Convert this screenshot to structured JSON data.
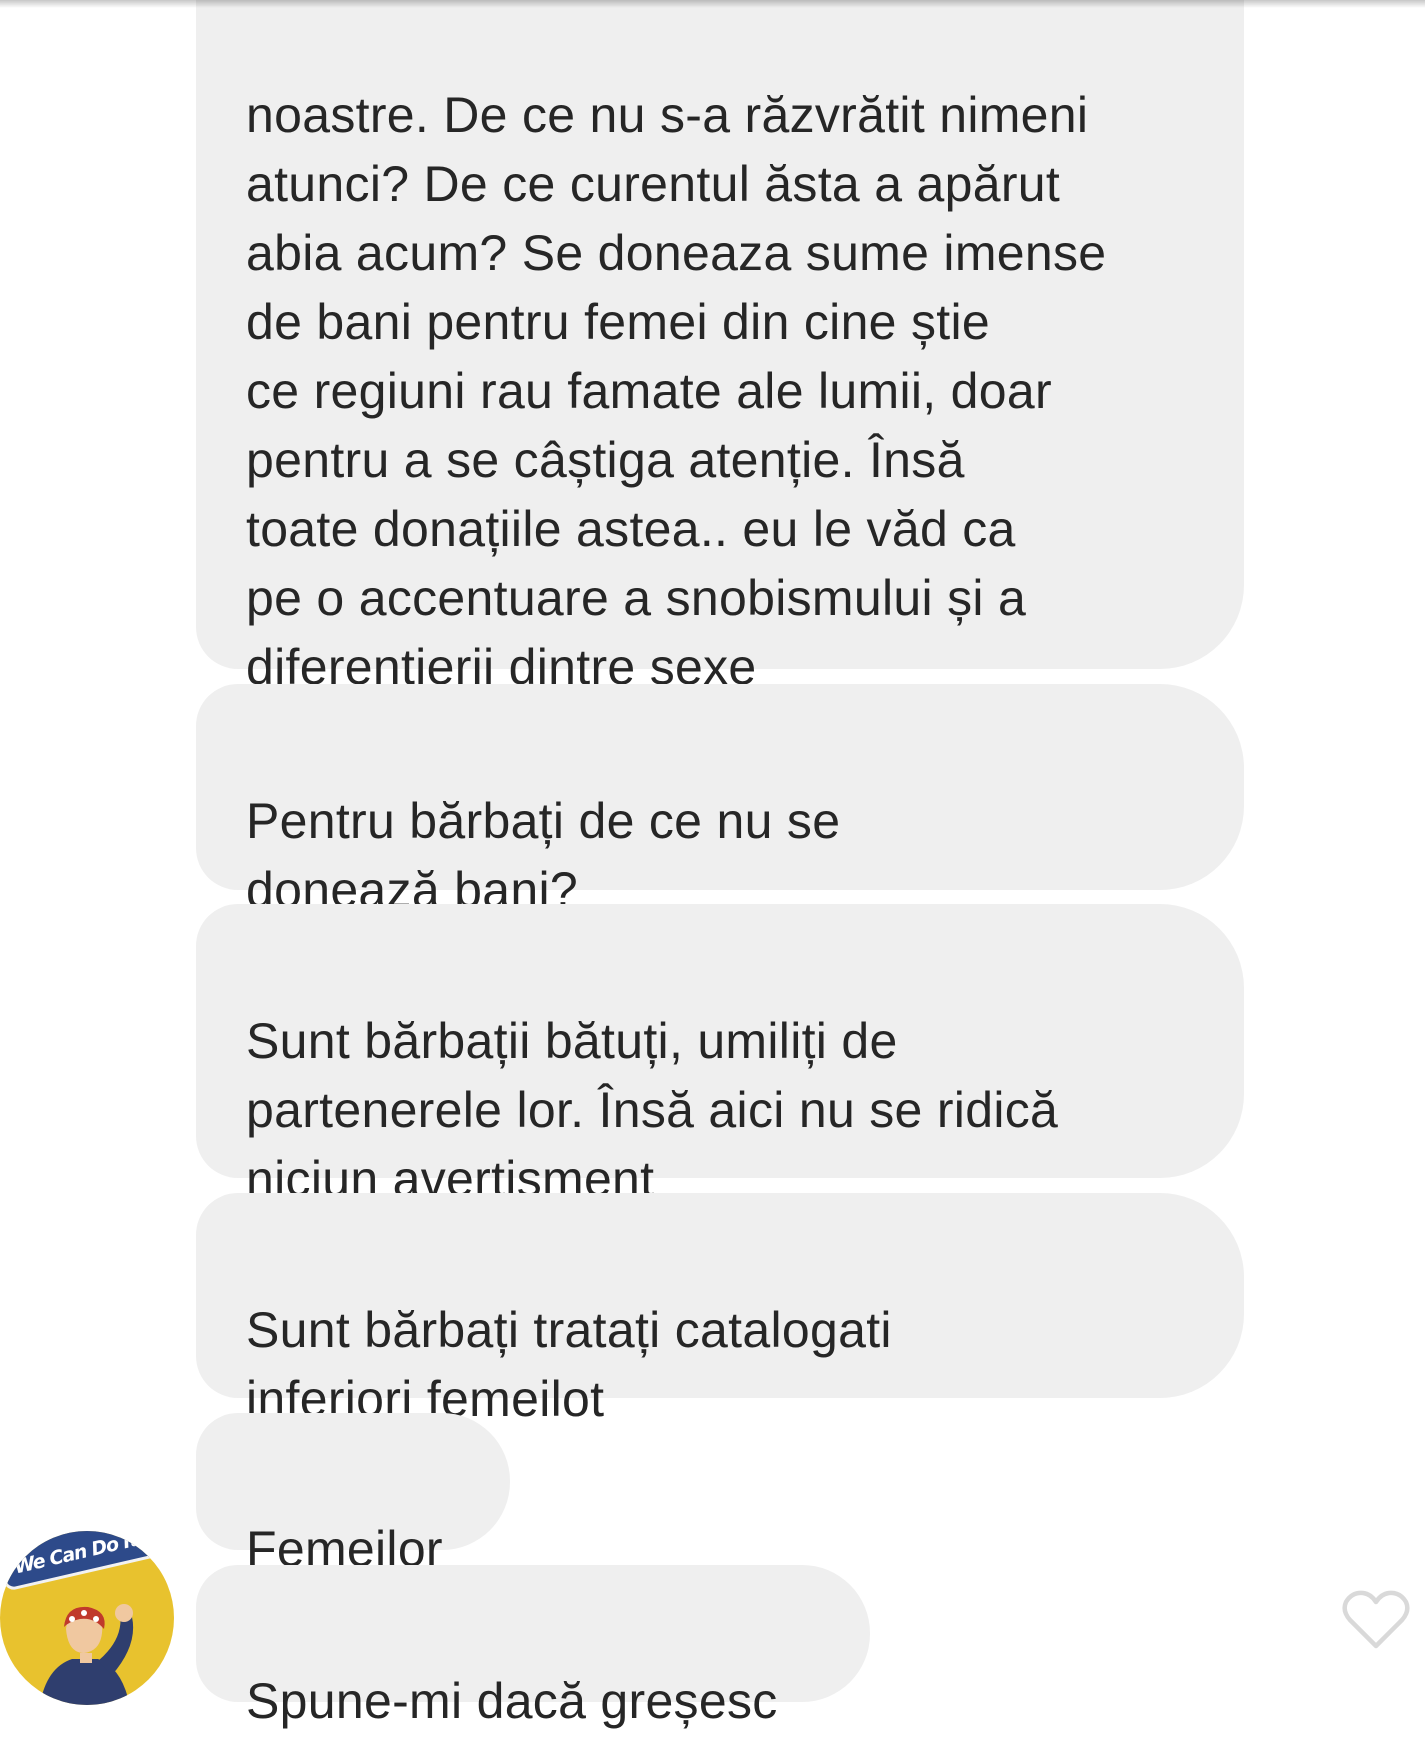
{
  "messages": [
    {
      "text": "noastre. De ce nu s-a răzvrătit nimeni\natunci? De ce curentul ăsta a apărut\nabia acum? Se doneaza sume imense\nde bani pentru femei din cine știe\nce regiuni rau famate ale lumii, doar\npentru a se câștiga atenție. Însă\ntoate donațiile astea.. eu le văd ca\npe o accentuare a snobismului și a\ndiferențierii dintre sexe"
    },
    {
      "text": "Pentru bărbați de ce nu se\ndonează bani?"
    },
    {
      "text": "Sunt bărbații bătuți, umiliți de\npartenerele lor. Însă aici nu se ridică\nniciun avertisment"
    },
    {
      "text": "Sunt bărbați tratați catalogati\ninferiori femeilot"
    },
    {
      "text": "Femeilor"
    },
    {
      "text": "Spune-mi dacă greșesc"
    }
  ],
  "avatar": {
    "badge_text": "We Can Do It!",
    "banner_color": "#2d4a8a",
    "background_color": "#e8c22e"
  },
  "icons": {
    "like": "heart-outline-icon"
  },
  "colors": {
    "bubble": "#efefef",
    "text": "#262626",
    "heart_outline": "#d9d9d9"
  }
}
